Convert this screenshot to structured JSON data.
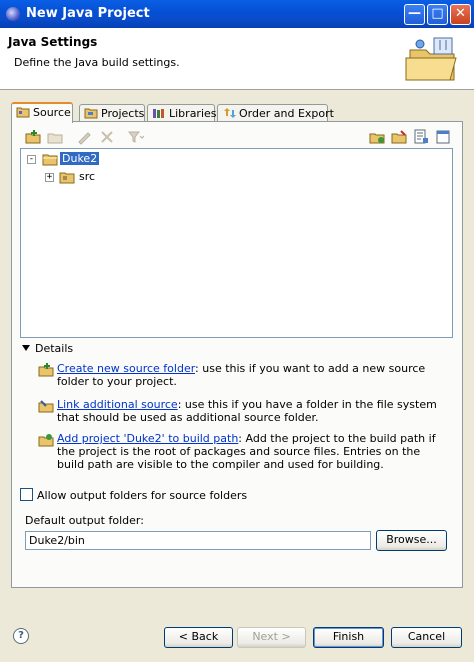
{
  "window": {
    "title": "New Java Project"
  },
  "header": {
    "title": "Java Settings",
    "description": "Define the Java build settings."
  },
  "tabs": [
    {
      "label": "Source",
      "icon": "source-folder-icon",
      "active": true
    },
    {
      "label": "Projects",
      "icon": "projects-icon",
      "active": false
    },
    {
      "label": "Libraries",
      "icon": "libraries-icon",
      "active": false
    },
    {
      "label": "Order and Export",
      "icon": "order-export-icon",
      "active": false
    }
  ],
  "tree": {
    "project": "Duke2",
    "children": [
      {
        "label": "src"
      }
    ]
  },
  "details": {
    "label": "Details",
    "items": [
      {
        "link": "Create new source folder",
        "text": ": use this if you want to add a new source folder to your project."
      },
      {
        "link": "Link additional source",
        "text": ": use this if you have a folder in the file system that should be used as additional source folder."
      },
      {
        "link": "Add project 'Duke2' to build path",
        "text": ": Add the project to the build path if the project is the root of packages and source files. Entries on the build path are visible to the compiler and used for building."
      }
    ]
  },
  "options": {
    "allow_output_folders": "Allow output folders for source folders"
  },
  "output": {
    "label": "Default output folder:",
    "value": "Duke2/bin",
    "browse": "Browse..."
  },
  "buttons": {
    "back": "< Back",
    "next": "Next >",
    "finish": "Finish",
    "cancel": "Cancel",
    "help": "?"
  },
  "colors": {
    "selection": "#316ac5",
    "link": "#0033cc",
    "titlebar": "#0550d6",
    "tab_accent": "#e68b2c"
  }
}
